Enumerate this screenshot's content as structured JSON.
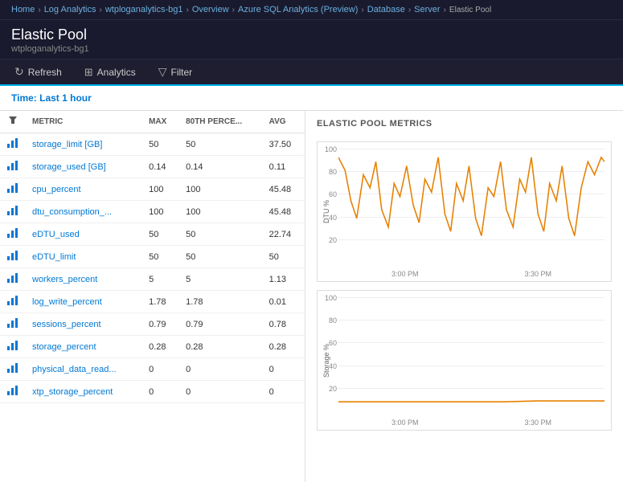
{
  "breadcrumb": {
    "items": [
      "Home",
      "Log Analytics",
      "wtploganalytics-bg1",
      "Overview",
      "Azure SQL Analytics (Preview)",
      "Database",
      "Server",
      "Elastic Pool"
    ]
  },
  "header": {
    "title": "Elastic Pool",
    "subtitle": "wtploganalytics-bg1"
  },
  "toolbar": {
    "refresh_label": "Refresh",
    "analytics_label": "Analytics",
    "filter_label": "Filter"
  },
  "time_bar": {
    "label": "Time: Last 1 hour"
  },
  "table": {
    "columns": [
      "",
      "METRIC",
      "MAX",
      "80TH PERCE...",
      "AVG"
    ],
    "rows": [
      {
        "metric": "storage_limit [GB]",
        "max": "50",
        "p80": "50",
        "avg": "37.50"
      },
      {
        "metric": "storage_used [GB]",
        "max": "0.14",
        "p80": "0.14",
        "avg": "0.11"
      },
      {
        "metric": "cpu_percent",
        "max": "100",
        "p80": "100",
        "avg": "45.48"
      },
      {
        "metric": "dtu_consumption_...",
        "max": "100",
        "p80": "100",
        "avg": "45.48"
      },
      {
        "metric": "eDTU_used",
        "max": "50",
        "p80": "50",
        "avg": "22.74"
      },
      {
        "metric": "eDTU_limit",
        "max": "50",
        "p80": "50",
        "avg": "50"
      },
      {
        "metric": "workers_percent",
        "max": "5",
        "p80": "5",
        "avg": "1.13"
      },
      {
        "metric": "log_write_percent",
        "max": "1.78",
        "p80": "1.78",
        "avg": "0.01"
      },
      {
        "metric": "sessions_percent",
        "max": "0.79",
        "p80": "0.79",
        "avg": "0.78"
      },
      {
        "metric": "storage_percent",
        "max": "0.28",
        "p80": "0.28",
        "avg": "0.28"
      },
      {
        "metric": "physical_data_read...",
        "max": "0",
        "p80": "0",
        "avg": "0"
      },
      {
        "metric": "xtp_storage_percent",
        "max": "0",
        "p80": "0",
        "avg": "0"
      }
    ]
  },
  "charts": {
    "section_title": "ELASTIC POOL METRICS",
    "chart1": {
      "y_label": "DTU %",
      "x_labels": [
        "3:00 PM",
        "3:30 PM"
      ],
      "y_ticks": [
        20,
        40,
        60,
        80,
        100
      ]
    },
    "chart2": {
      "y_label": "Storage %",
      "x_labels": [
        "3:00 PM",
        "3:30 PM"
      ],
      "y_ticks": [
        20,
        40,
        60,
        80,
        100
      ]
    }
  }
}
